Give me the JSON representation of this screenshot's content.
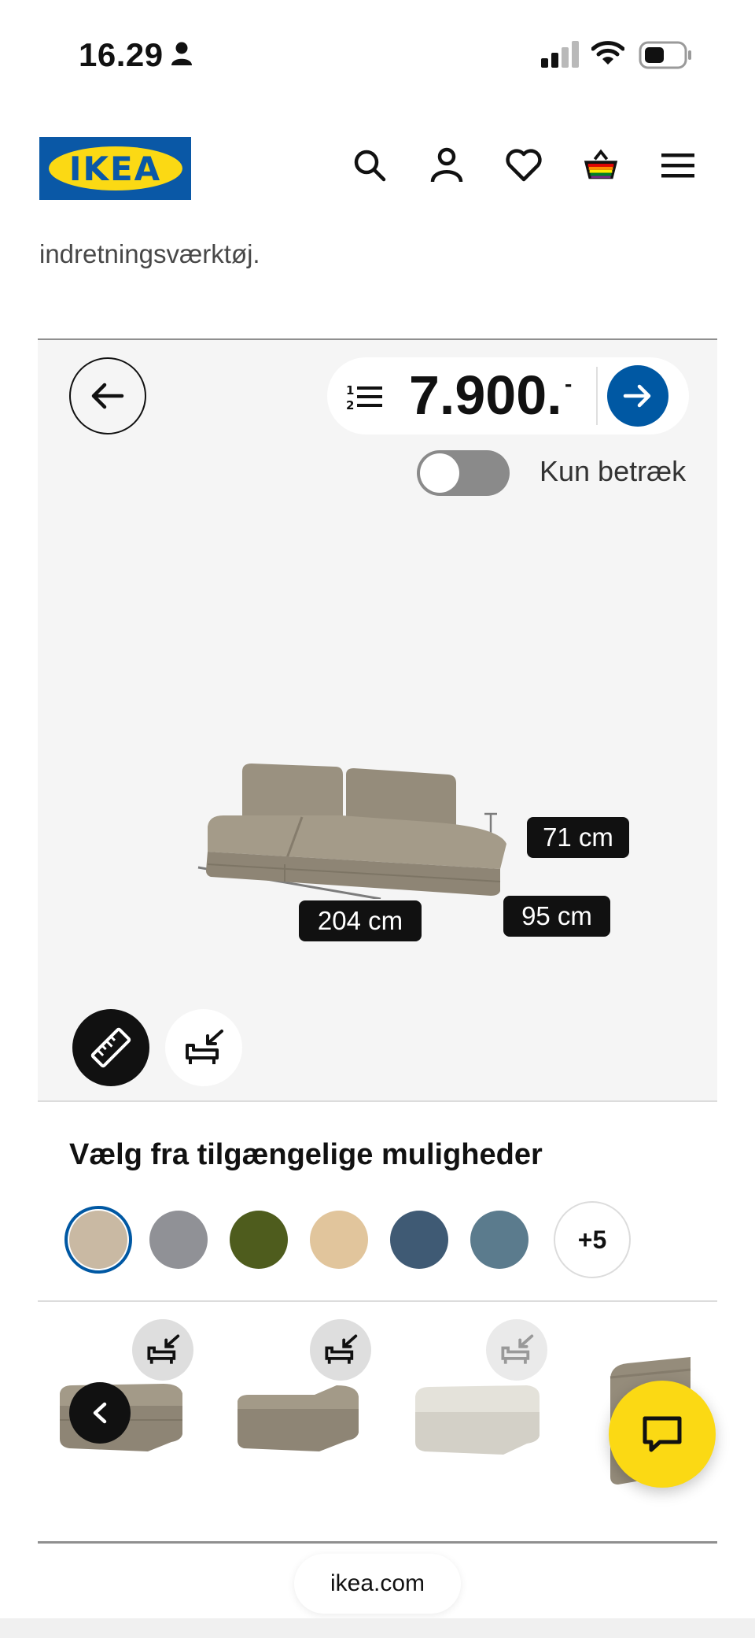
{
  "status_bar": {
    "time": "16.29",
    "icons": [
      "person-icon",
      "signal-icon",
      "wifi-icon",
      "battery-icon"
    ]
  },
  "header": {
    "logo_text": "IKEA",
    "icons": [
      "search-icon",
      "account-icon",
      "heart-icon",
      "basket-icon",
      "menu-icon"
    ]
  },
  "intro_text": "indretningsværktøj.",
  "configurator": {
    "price": "7.900.",
    "price_suffix": "-",
    "toggle_label": "Kun betræk",
    "toggle_on": false,
    "dimensions": {
      "width": "204 cm",
      "depth": "95 cm",
      "height": "71 cm"
    }
  },
  "options": {
    "title": "Vælg fra tilgængelige muligheder",
    "more_label": "+5",
    "swatches": [
      "#c9b9a3",
      "#909196",
      "#4e5c1d",
      "#e1c59c",
      "#3f5a74",
      "#5b7b8d"
    ]
  },
  "footer": {
    "url": "ikea.com"
  },
  "colors": {
    "ikea_blue": "#0058a3",
    "ikea_yellow": "#fbd914",
    "sofa": "#9b9281"
  }
}
